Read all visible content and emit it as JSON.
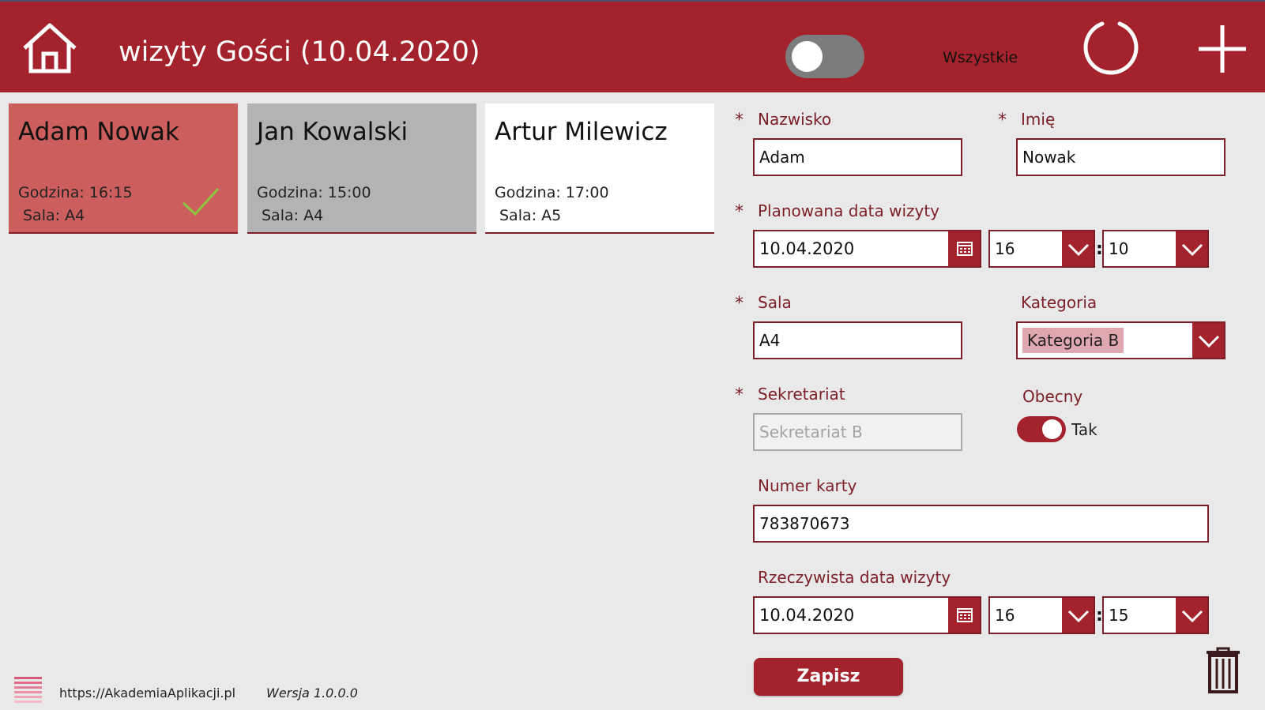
{
  "header": {
    "title": "wizyty Gości (10.04.2020)",
    "filter_label": "Wszystkie",
    "icons": [
      "home-icon",
      "refresh-icon",
      "add-icon"
    ]
  },
  "colors": {
    "primary": "#a4222c",
    "dark_accent": "#7c1f27",
    "selected_card": "#cc5e5e",
    "grey_card": "#b3b3b3",
    "check": "#8cc63f"
  },
  "cards": [
    {
      "name": "Adam Nowak",
      "time": "Godzina: 16:15",
      "room": " Sala: A4",
      "state": "selected",
      "checked": true
    },
    {
      "name": "Jan Kowalski",
      "time": "Godzina: 15:00",
      "room": " Sala: A4",
      "state": "grey",
      "checked": false
    },
    {
      "name": "Artur Milewicz",
      "time": "Godzina: 17:00",
      "room": " Sala: A5",
      "state": "white",
      "checked": false
    }
  ],
  "form": {
    "required_mark": "*",
    "nazwisko": {
      "label": "Nazwisko",
      "value": "Adam"
    },
    "imie": {
      "label": "Imię",
      "value": "Nowak"
    },
    "planned": {
      "label": "Planowana data wizyty",
      "date": "10.04.2020",
      "hour": "16",
      "minute": "10"
    },
    "sala": {
      "label": "Sala",
      "value": "A4"
    },
    "kategoria": {
      "label": "Kategoria",
      "value": "Kategoria B"
    },
    "sekretariat": {
      "label": "Sekretariat",
      "value": "Sekretariat B"
    },
    "obecny": {
      "label": "Obecny",
      "value": "Tak",
      "on": true
    },
    "numer": {
      "label": "Numer karty",
      "value": "783870673"
    },
    "actual": {
      "label": "Rzeczywista data wizyty",
      "date": "10.04.2020",
      "hour": "16",
      "minute": "15"
    },
    "time_separator": ":",
    "save_label": "Zapisz"
  },
  "footer": {
    "link": "https://AkademiaAplikacji.pl",
    "version": "Wersja 1.0.0.0"
  }
}
